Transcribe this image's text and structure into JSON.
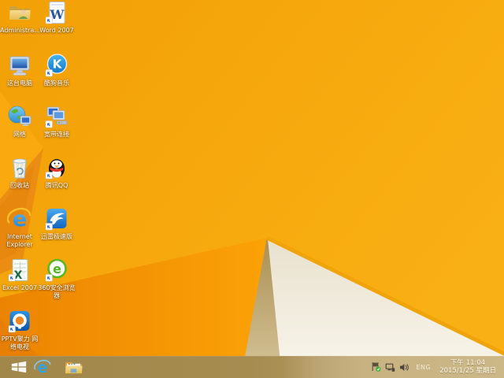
{
  "wallpaper": {
    "theme": "windows-8.1-default-orange",
    "colors": {
      "base_top": "#f5a60a",
      "fold_bright_left": "#ee8a04",
      "fold_dark_wedge": "#e8860c",
      "shadow_tan": "#bca275",
      "paper_white": "#f2ecdc",
      "edge_stripe": "#f1a40a"
    }
  },
  "desktop": {
    "icons": [
      {
        "name": "administrator-folder",
        "icon": "user-folder-icon",
        "label_lines": [
          "Administra..."
        ]
      },
      {
        "name": "word-2007",
        "icon": "word-document-icon",
        "label_lines": [
          "Word 2007"
        ]
      },
      {
        "name": "this-pc",
        "icon": "computer-monitor-icon",
        "label_lines": [
          "这台电脑"
        ]
      },
      {
        "name": "kugou-music",
        "icon": "kugou-k-icon",
        "label_lines": [
          "酷狗音乐"
        ]
      },
      {
        "name": "network",
        "icon": "globe-monitor-icon",
        "label_lines": [
          "网络"
        ]
      },
      {
        "name": "broadband-connection",
        "icon": "monitors-modem-icon",
        "label_lines": [
          "宽带连接"
        ]
      },
      {
        "name": "recycle-bin",
        "icon": "recycle-bin-icon",
        "label_lines": [
          "回收站"
        ]
      },
      {
        "name": "tencent-qq",
        "icon": "qq-penguin-icon",
        "label_lines": [
          "腾讯QQ"
        ]
      },
      {
        "name": "internet-explorer",
        "icon": "ie-e-icon",
        "label_lines": [
          "Internet",
          "Explorer"
        ]
      },
      {
        "name": "thunder-speed",
        "icon": "thunder-bird-icon",
        "label_lines": [
          "迅雷极速版"
        ]
      },
      {
        "name": "excel-2007",
        "icon": "excel-sheet-icon",
        "label_lines": [
          "Excel 2007"
        ]
      },
      {
        "name": "360-secure-browser",
        "icon": "360-green-e-icon",
        "label_lines": [
          "360安全浏览",
          "器"
        ]
      },
      {
        "name": "pptv",
        "icon": "pptv-circle-icon",
        "label_lines": [
          "PPTV聚力 网",
          "络电视"
        ]
      }
    ]
  },
  "taskbar": {
    "buttons": [
      {
        "name": "start-button",
        "icon": "windows-logo-icon"
      },
      {
        "name": "ie-taskbar",
        "icon": "ie-e-icon"
      },
      {
        "name": "file-explorer",
        "icon": "folder-icon"
      }
    ],
    "tray": {
      "icons": [
        {
          "name": "action-center-icon"
        },
        {
          "name": "network-status-icon"
        },
        {
          "name": "volume-icon"
        }
      ],
      "language": "ENG",
      "time": "下午 11:04",
      "date": "2015/1/25 星期日"
    }
  }
}
